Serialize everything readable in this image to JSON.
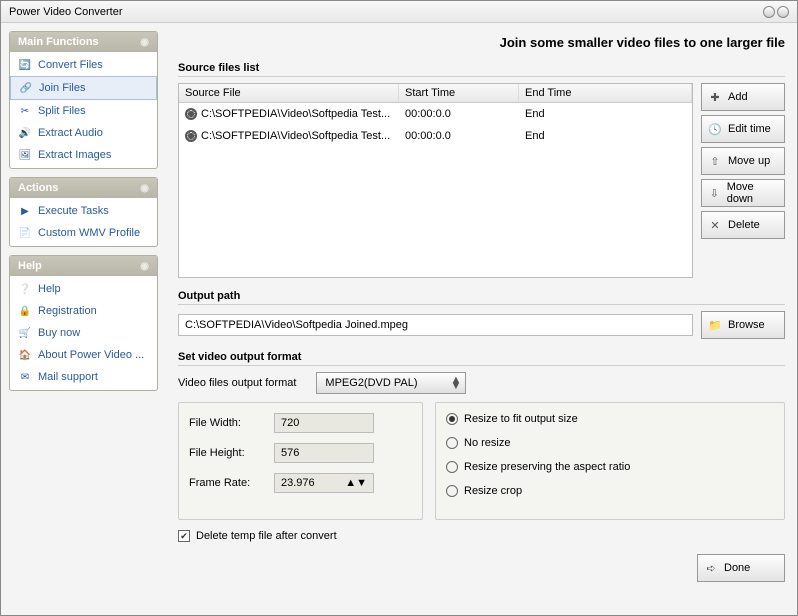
{
  "window": {
    "title": "Power Video Converter"
  },
  "sidebar": {
    "mainFunctions": {
      "header": "Main Functions",
      "items": [
        {
          "label": "Convert Files",
          "icon": "🔄"
        },
        {
          "label": "Join Files",
          "icon": "🔗"
        },
        {
          "label": "Split Files",
          "icon": "✂"
        },
        {
          "label": "Extract Audio",
          "icon": "🔊"
        },
        {
          "label": "Extract Images",
          "icon": "🖼"
        }
      ]
    },
    "actions": {
      "header": "Actions",
      "items": [
        {
          "label": "Execute Tasks",
          "icon": "▶"
        },
        {
          "label": "Custom WMV Profile",
          "icon": "📄"
        }
      ]
    },
    "help": {
      "header": "Help",
      "items": [
        {
          "label": "Help",
          "icon": "❔"
        },
        {
          "label": "Registration",
          "icon": "🔒"
        },
        {
          "label": "Buy now",
          "icon": "🛒"
        },
        {
          "label": "About Power Video ...",
          "icon": "🏠"
        },
        {
          "label": "Mail support",
          "icon": "✉"
        }
      ]
    }
  },
  "page": {
    "title": "Join some smaller video files to one larger  file",
    "sourceLabel": "Source files list",
    "columns": {
      "sf": "Source File",
      "st": "Start Time",
      "et": "End Time"
    },
    "files": [
      {
        "path": "C:\\SOFTPEDIA\\Video\\Softpedia Test...",
        "start": "00:00:0.0",
        "end": "End"
      },
      {
        "path": "C:\\SOFTPEDIA\\Video\\Softpedia Test...",
        "start": "00:00:0.0",
        "end": "End"
      }
    ],
    "buttons": {
      "add": "Add",
      "editTime": "Edit time",
      "moveUp": "Move up",
      "moveDown": "Move down",
      "delete": "Delete",
      "browse": "Browse",
      "done": "Done"
    },
    "outputLabel": "Output path",
    "outputPath": "C:\\SOFTPEDIA\\Video\\Softpedia Joined.mpeg",
    "formatLabel": "Set video output format",
    "formatRowLabel": "Video files output format",
    "formatValue": "MPEG2(DVD PAL)",
    "dims": {
      "widthLabel": "File Width:",
      "width": "720",
      "heightLabel": "File Height:",
      "height": "576",
      "fpsLabel": "Frame Rate:",
      "fps": "23.976"
    },
    "resize": {
      "fit": "Resize to fit output size",
      "none": "No resize",
      "aspect": "Resize preserving the aspect ratio",
      "crop": "Resize crop"
    },
    "deleteTemp": "Delete temp file after convert"
  }
}
